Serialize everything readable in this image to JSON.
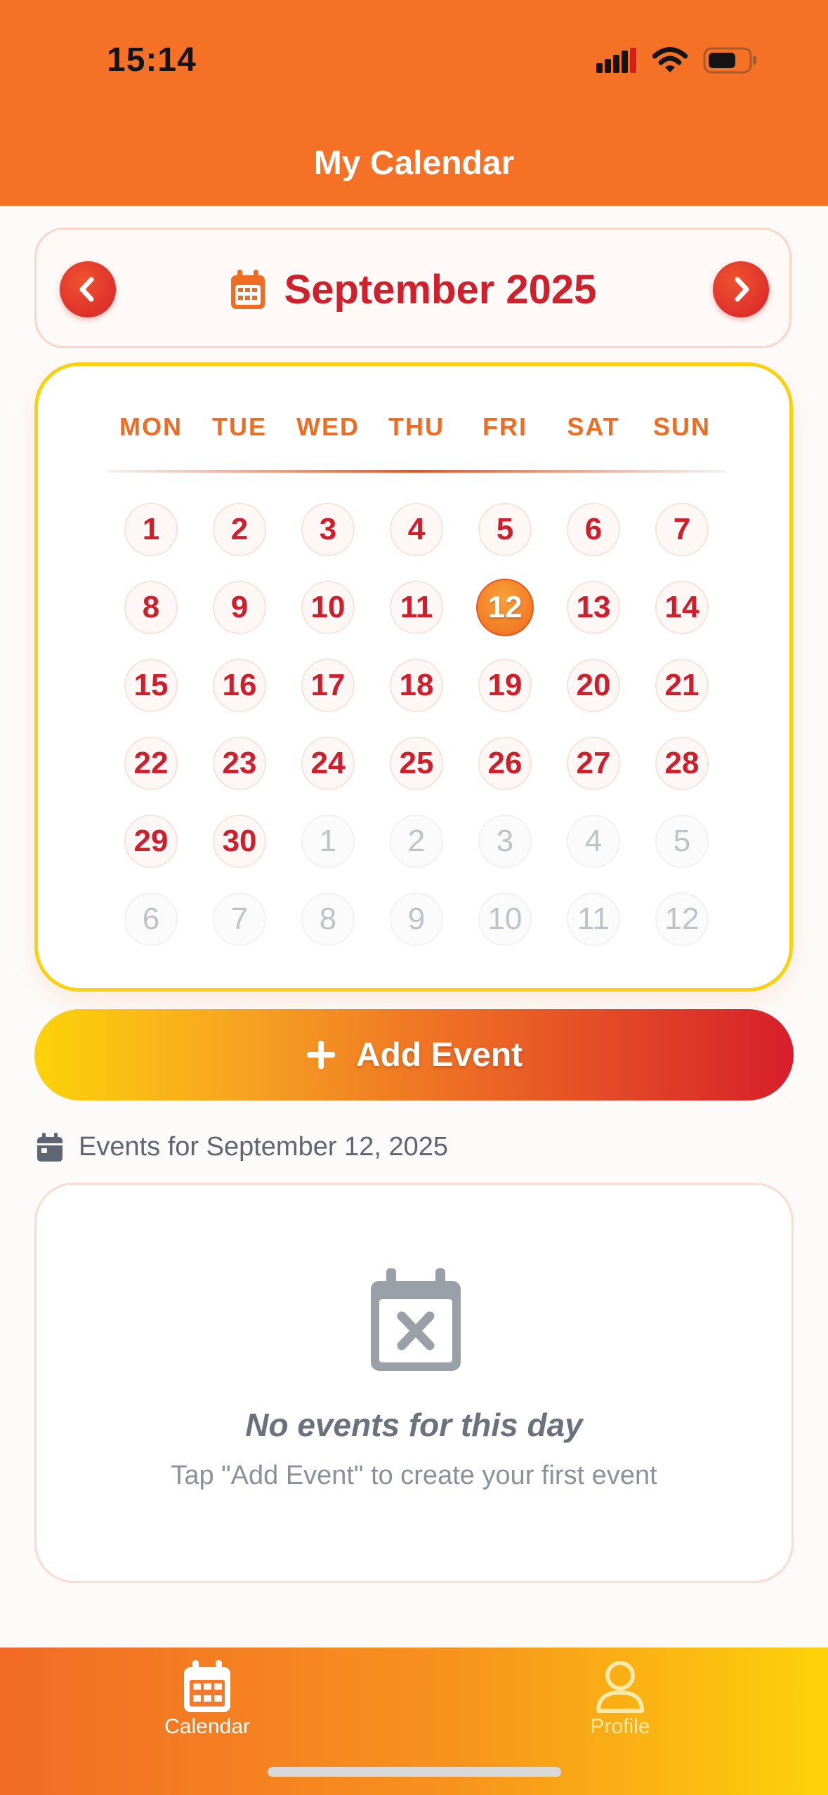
{
  "status_bar": {
    "time": "15:14"
  },
  "header": {
    "title": "My Calendar"
  },
  "month_nav": {
    "label": "September 2025"
  },
  "calendar": {
    "weekdays": [
      "MON",
      "TUE",
      "WED",
      "THU",
      "FRI",
      "SAT",
      "SUN"
    ],
    "selected_day": "12",
    "weeks": [
      [
        "1",
        "2",
        "3",
        "4",
        "5",
        "6",
        "7"
      ],
      [
        "8",
        "9",
        "10",
        "11",
        "12",
        "13",
        "14"
      ],
      [
        "15",
        "16",
        "17",
        "18",
        "19",
        "20",
        "21"
      ],
      [
        "22",
        "23",
        "24",
        "25",
        "26",
        "27",
        "28"
      ],
      [
        "29",
        "30",
        "1",
        "2",
        "3",
        "4",
        "5"
      ],
      [
        "6",
        "7",
        "8",
        "9",
        "10",
        "11",
        "12"
      ]
    ]
  },
  "actions": {
    "add_event_label": "Add Event"
  },
  "events": {
    "heading": "Events for September 12, 2025",
    "empty_title": "No events for this day",
    "empty_subtitle": "Tap \"Add Event\" to create your first event"
  },
  "tabbar": {
    "calendar_label": "Calendar",
    "profile_label": "Profile"
  },
  "colors": {
    "header": "#f47125",
    "accent_red": "#d0202c",
    "accent_orange": "#ef6c23",
    "accent_yellow": "#fed20a",
    "muted_text": "#5f6673"
  }
}
